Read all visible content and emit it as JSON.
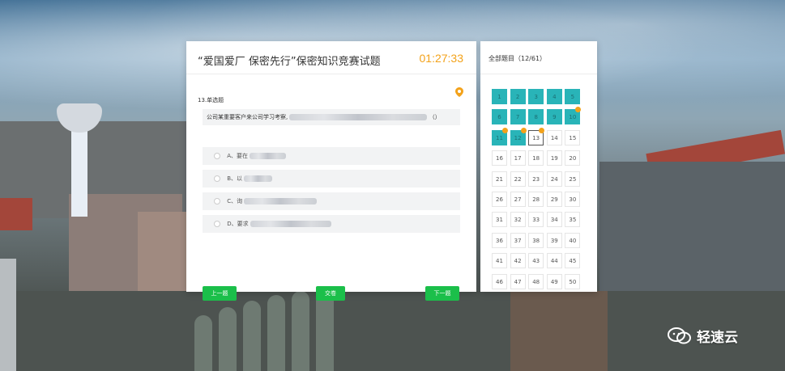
{
  "exam": {
    "title": "“爱国爱厂 保密先行”保密知识竞赛试题",
    "timer": "01:27:33",
    "question_type": "13.单选题",
    "question_prefix": "公司某重要客户来公司学习考察,",
    "question_suffix": "（）",
    "options": [
      {
        "label": "A、要在",
        "hidden": true
      },
      {
        "label": "B、以",
        "hidden": true
      },
      {
        "label": "C、询",
        "hidden": true
      },
      {
        "label": "D、要求",
        "hidden": true
      }
    ],
    "prev_label": "上一题",
    "submit_label": "交卷",
    "next_label": "下一题"
  },
  "navigator": {
    "label": "全部题目（12/61）",
    "numbers": [
      "1",
      "2",
      "3",
      "4",
      "5",
      "6",
      "7",
      "8",
      "9",
      "10",
      "11",
      "12",
      "13",
      "14",
      "15",
      "16",
      "17",
      "18",
      "19",
      "20",
      "21",
      "22",
      "23",
      "24",
      "25",
      "26",
      "27",
      "28",
      "29",
      "30",
      "31",
      "32",
      "33",
      "34",
      "35",
      "36",
      "37",
      "38",
      "39",
      "40",
      "41",
      "42",
      "43",
      "44",
      "45",
      "46",
      "47",
      "48",
      "49",
      "50"
    ],
    "answered_count": 12,
    "current": 13,
    "marked": [
      10,
      11,
      12,
      13
    ]
  },
  "watermark": {
    "text": "轻速云"
  },
  "colors": {
    "accent_green": "#1bbf4a",
    "answered_teal": "#29b4b8",
    "timer_orange": "#f3a21a",
    "marker_orange": "#f3a21a"
  }
}
